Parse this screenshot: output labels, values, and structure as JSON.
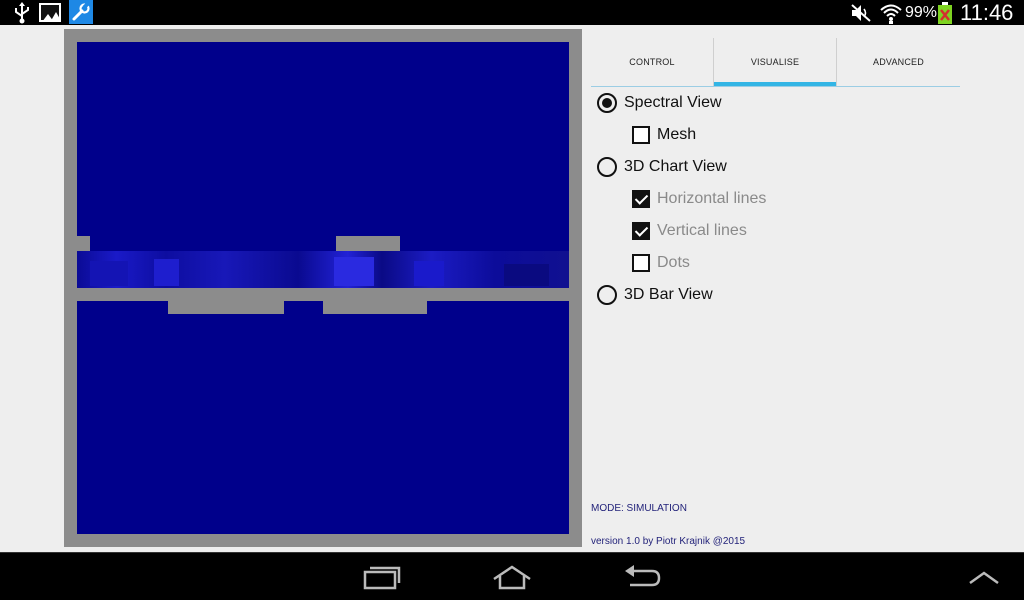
{
  "status_bar": {
    "icons": [
      "usb-icon",
      "gallery-icon",
      "wrench-icon",
      "mute-icon",
      "wifi-icon",
      "battery-icon"
    ],
    "battery_percent": "99%",
    "time": "11:46",
    "colors": {
      "background": "#000000",
      "wrench_tile": "#1e88e5"
    }
  },
  "spectral_view": {
    "colors": {
      "frame": "#8c8c8c",
      "field": "#00008b",
      "band_highlight": "#1c1ccf"
    }
  },
  "tabs": [
    {
      "label": "CONTROL",
      "selected": false
    },
    {
      "label": "VISUALISE",
      "selected": true
    },
    {
      "label": "ADVANCED",
      "selected": false
    }
  ],
  "tab_indicator_color": "#33b5e5",
  "options": {
    "spectral_view": {
      "label": "Spectral View",
      "selected": true
    },
    "mesh": {
      "label": "Mesh",
      "checked": false
    },
    "chart_3d_view": {
      "label": "3D Chart View",
      "selected": false
    },
    "horizontal_lines": {
      "label": "Horizontal lines",
      "checked": true
    },
    "vertical_lines": {
      "label": "Vertical lines",
      "checked": true
    },
    "dots": {
      "label": "Dots",
      "checked": false
    },
    "bar_3d_view": {
      "label": "3D Bar View",
      "selected": false
    }
  },
  "footer": {
    "mode": "MODE: SIMULATION",
    "version": "version 1.0 by Piotr Krajnik @2015"
  },
  "nav_bar": {
    "buttons": [
      "recent-apps-icon",
      "home-icon",
      "back-icon",
      "menu-up-icon"
    ]
  }
}
